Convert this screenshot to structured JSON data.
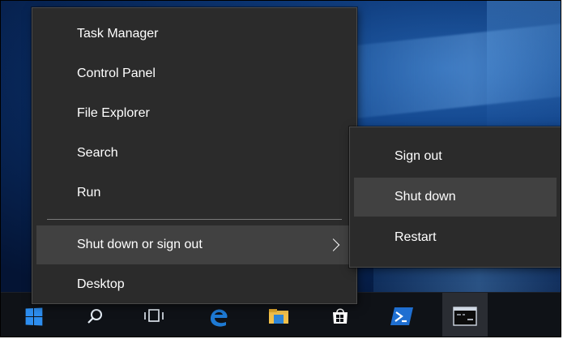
{
  "context_menu": {
    "items": [
      {
        "label": "Task Manager"
      },
      {
        "label": "Control Panel"
      },
      {
        "label": "File Explorer"
      },
      {
        "label": "Search"
      },
      {
        "label": "Run"
      },
      {
        "label": "Shut down or sign out",
        "has_submenu": true,
        "hovered": true
      },
      {
        "label": "Desktop"
      }
    ]
  },
  "submenu": {
    "items": [
      {
        "label": "Sign out"
      },
      {
        "label": "Shut down",
        "hovered": true
      },
      {
        "label": "Restart"
      }
    ]
  },
  "taskbar": {
    "icons": [
      "windows-start-icon",
      "search-icon",
      "task-view-icon",
      "edge-icon",
      "file-explorer-icon",
      "store-icon",
      "powershell-icon",
      "command-prompt-icon"
    ],
    "active_icon": "command-prompt-icon"
  },
  "colors": {
    "menu_bg": "#2b2b2b",
    "menu_hover": "#414141",
    "menu_text": "#ffffff",
    "accent_blue": "#2d8ef0",
    "taskbar_bg": "#0f1217"
  }
}
